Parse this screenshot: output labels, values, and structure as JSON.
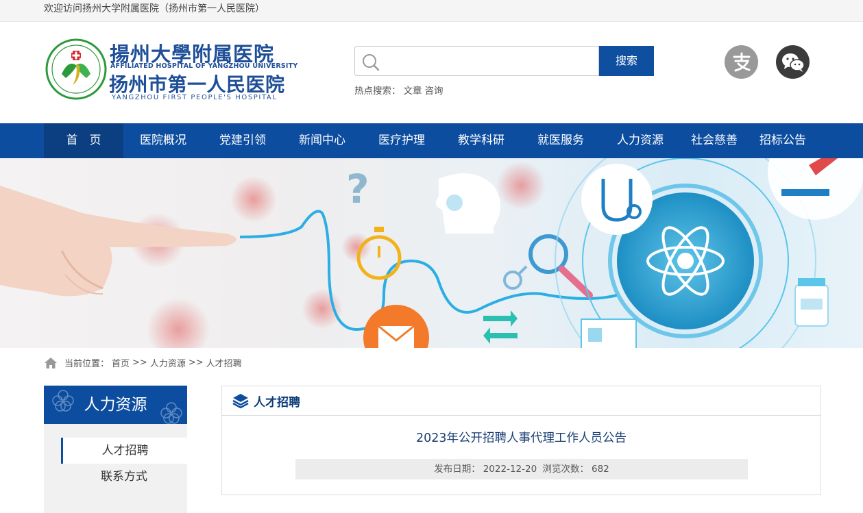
{
  "topbar": {
    "welcome": "欢迎访问扬州大学附属医院（扬州市第一人民医院）"
  },
  "logo": {
    "name_cn_1": "揚州大學附属医院",
    "name_en_1": "AFFILIATED HOSPITAL OF YANGZHOU UNIVERSITY",
    "name_cn_2": "扬州市第一人民医院",
    "name_en_2": "YANGZHOU FIRST PEOPLE'S HOSPITAL"
  },
  "search": {
    "value": "",
    "button": "搜索",
    "hot_label": "热点搜索：",
    "hot_terms": [
      "文章",
      "咨询"
    ]
  },
  "nav": {
    "items": [
      "首　页",
      "医院概况",
      "党建引领",
      "新闻中心",
      "医疗护理",
      "教学科研",
      "就医服务",
      "人力资源",
      "社会慈善",
      "招标公告"
    ]
  },
  "breadcrumb": {
    "label": "当前位置：",
    "items": [
      "首页",
      "人力资源",
      "人才招聘"
    ],
    "separator": ">>"
  },
  "sidebar": {
    "title": "人力资源",
    "items": [
      "人才招聘",
      "联系方式"
    ]
  },
  "main": {
    "section_title": "人才招聘",
    "article_title": "2023年公开招聘人事代理工作人员公告",
    "date_label": "发布日期：",
    "date": "2022-12-20",
    "views_label": "浏览次数：",
    "views": "682"
  },
  "colors": {
    "brand_blue": "#0c4da0",
    "nav_active": "#0b3f82",
    "logo_green": "#2c9a3a"
  },
  "icons": [
    "search-icon",
    "alipay-icon",
    "wechat-icon",
    "home-icon",
    "layers-icon"
  ]
}
